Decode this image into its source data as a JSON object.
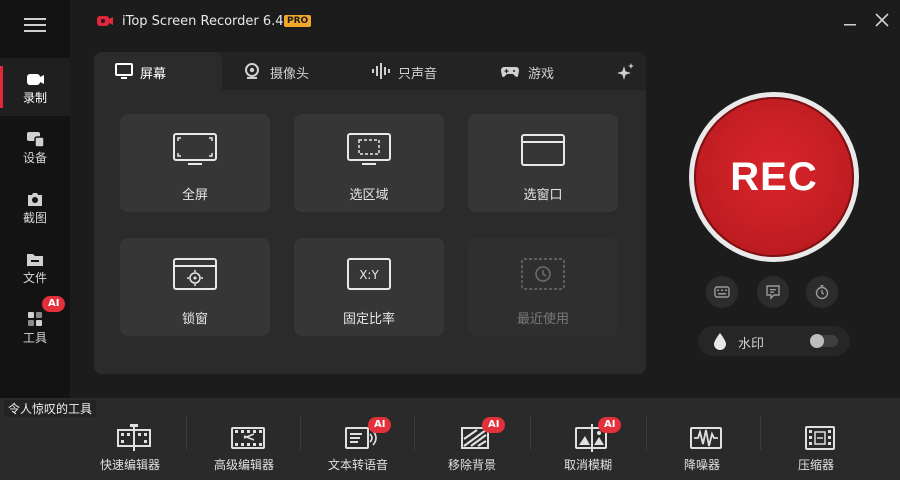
{
  "app": {
    "title": "iTop Screen Recorder 6.4",
    "badge": "PRO"
  },
  "sidebar": {
    "items": [
      {
        "label": "录制"
      },
      {
        "label": "设备"
      },
      {
        "label": "截图"
      },
      {
        "label": "文件"
      },
      {
        "label": "工具",
        "badge": "AI"
      }
    ]
  },
  "tabs": [
    {
      "label": "屏幕"
    },
    {
      "label": "摄像头"
    },
    {
      "label": "只声音"
    },
    {
      "label": "游戏"
    }
  ],
  "modes": [
    {
      "label": "全屏"
    },
    {
      "label": "选区域"
    },
    {
      "label": "选窗口"
    },
    {
      "label": "锁窗"
    },
    {
      "label": "固定比率",
      "icon_text": "X:Y"
    },
    {
      "label": "最近使用"
    }
  ],
  "rec": {
    "label": "REC"
  },
  "watermark": {
    "label": "水印"
  },
  "tools": {
    "title": "令人惊叹的工具",
    "items": [
      {
        "label": "快速编辑器"
      },
      {
        "label": "高级编辑器"
      },
      {
        "label": "文本转语音",
        "badge": "AI"
      },
      {
        "label": "移除背景",
        "badge": "AI"
      },
      {
        "label": "取消模糊",
        "badge": "AI"
      },
      {
        "label": "降噪器"
      },
      {
        "label": "压缩器"
      }
    ]
  },
  "colors": {
    "accent": "#e0283a",
    "rec": "#c01d22",
    "pro": "#f0a72a"
  }
}
